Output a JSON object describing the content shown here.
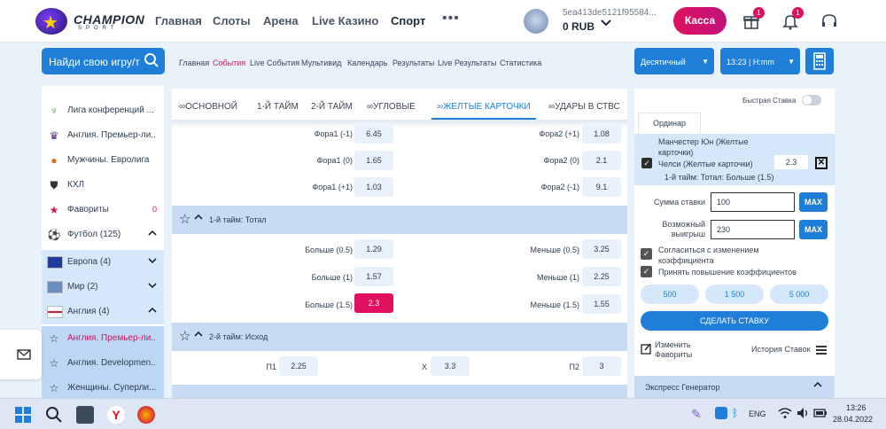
{
  "header": {
    "brand": "CHAMPION",
    "brand_sub": "SPORT",
    "nav": [
      "Главная",
      "Слоты",
      "Арена",
      "Live Казино",
      "Спорт"
    ],
    "more": "•••",
    "account_id": "5ea413de5121f95584...",
    "balance": "0 RUB",
    "cashbox": "Касса",
    "gift_badge": "1",
    "bell_badge": "1"
  },
  "subbar": {
    "search_label": "Найди свою игру/т",
    "links": [
      "Главная",
      "События",
      "Live События",
      "Мультивид",
      "Календарь",
      "Результаты",
      "Live Результаты",
      "Статистика"
    ],
    "odds_format": "Десятичный",
    "time_format": "13:23 | H:mm"
  },
  "sidebar": {
    "items": [
      {
        "label": "Лига конференций ...",
        "right": ""
      },
      {
        "label": "Англия. Премьер-ли...",
        "right": ""
      },
      {
        "label": "Мужчины. Евролига",
        "right": ""
      },
      {
        "label": "КХЛ",
        "right": ""
      },
      {
        "label": "Фавориты",
        "right": "0"
      },
      {
        "label": "Футбол (125)",
        "right": "^"
      },
      {
        "label": "Европа (4)",
        "right": "v"
      },
      {
        "label": "Мир (2)",
        "right": "v"
      },
      {
        "label": "Англия (4)",
        "right": "^"
      },
      {
        "label": "Англия. Премьер-ли...",
        "right": ""
      },
      {
        "label": "Англия. Developmen...",
        "right": ""
      },
      {
        "label": "Женщины. Суперли...",
        "right": ""
      }
    ]
  },
  "tabs": [
    "ОСНОВНОЙ",
    "1-Й ТАЙМ",
    "2-Й ТАЙМ",
    "УГЛОВЫЕ",
    "ЖЕЛТЫЕ КАРТОЧКИ",
    "УДАРЫ В СТВС"
  ],
  "markets": {
    "handicap_rows": [
      {
        "l": "Фора1 (-1)",
        "lo": "6.45",
        "r": "Фора2 (+1)",
        "ro": "1.08"
      },
      {
        "l": "Фора1 (0)",
        "lo": "1.65",
        "r": "Фора2 (0)",
        "ro": "2.1"
      },
      {
        "l": "Фора1 (+1)",
        "lo": "1.03",
        "r": "Фора2 (-1)",
        "ro": "9.1"
      }
    ],
    "total_title": "1-й тайм: Тотал",
    "total_rows": [
      {
        "l": "Больше (0.5)",
        "lo": "1.29",
        "r": "Меньше (0.5)",
        "ro": "3.25"
      },
      {
        "l": "Больше (1)",
        "lo": "1.57",
        "r": "Меньше (1)",
        "ro": "2.25"
      },
      {
        "l": "Больше (1.5)",
        "lo": "2.3",
        "r": "Меньше (1.5)",
        "ro": "1.55"
      }
    ],
    "outcome_title": "2-й тайм: Исход",
    "outcome": {
      "p1": "П1",
      "p1o": "2.25",
      "x": "X",
      "xo": "3.3",
      "p2": "П2",
      "p2o": "3"
    }
  },
  "slip": {
    "quick_bet": "Быстрая Ставка",
    "tab": "Ординар",
    "bet_line1": "Манчестер Юн (Желтые",
    "bet_line2": "карточки)",
    "bet_line3": "Челси (Желтые карточки)",
    "bet_line4": "1-й тайм: Тотал: Больше (1.5)",
    "bet_odd": "2.3",
    "stake_label": "Сумма ставки",
    "stake_value": "100",
    "win_label1": "Возможный",
    "win_label2": "выигрыш",
    "win_value": "230",
    "max": "MAX",
    "agree1": "Согласиться с изменением",
    "agree2": "коэффициента",
    "accept": "Принять повышение коэффициентов",
    "quick_amounts": [
      "500",
      "1 500",
      "5 000"
    ],
    "make_bet": "СДЕЛАТЬ СТАВКУ",
    "edit_fav1": "Изменить",
    "edit_fav2": "Фавориты",
    "history": "История Ставок",
    "express": "Экспресс Генератор"
  },
  "taskbar": {
    "lang": "ENG",
    "time": "13:26",
    "date": "28.04.2022"
  },
  "colors": {
    "accent": "#1e7ed8",
    "brand": "#e0105f",
    "panel": "#c7dcf3"
  }
}
